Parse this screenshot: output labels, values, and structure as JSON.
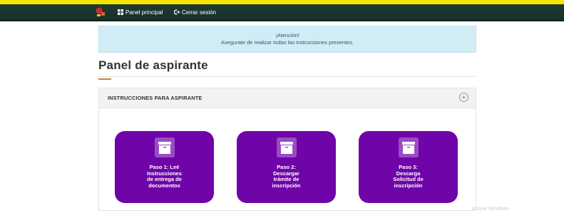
{
  "nav": {
    "panel_label": "Panel principal",
    "logout_label": "Cerrar sesión",
    "colors": {
      "bar": "#1f3b33",
      "top_strip": "#f5e500"
    }
  },
  "alert": {
    "heading": "¡Atención!",
    "message": "Asegurate de realizar todas las instrucciones presentes."
  },
  "page": {
    "title": "Panel de aspirante",
    "accent": "#c9803a"
  },
  "instructions": {
    "header": "INSTRUCCIONES PARA ASPIRANTE",
    "toggle_icon": "plus-circle-icon",
    "steps": [
      {
        "icon": "archive-box-icon",
        "lines": [
          "Paso 1: Leé",
          "Instrucciones",
          "de entrega de",
          "documentos"
        ]
      },
      {
        "icon": "archive-box-icon",
        "lines": [
          "Paso 2:",
          "Descargar",
          "trámite de",
          "inscripción"
        ]
      },
      {
        "icon": "archive-box-icon",
        "lines": [
          "Paso 3:",
          "Descarga",
          "Solicitud de",
          "inscripción"
        ]
      }
    ],
    "step_color": "#6f05a8"
  },
  "watermark": "Activar Windows"
}
